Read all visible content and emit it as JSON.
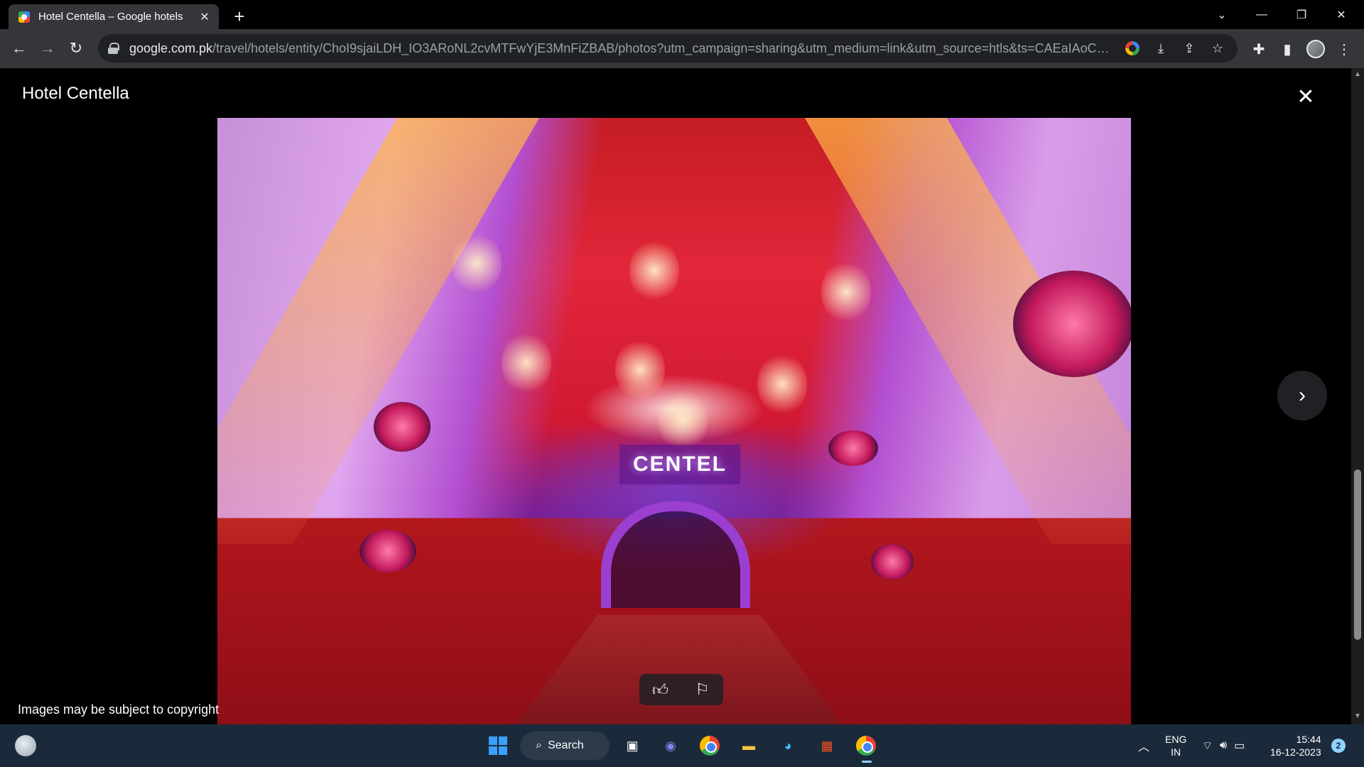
{
  "browser": {
    "tab_title": "Hotel Centella – Google hotels",
    "tab_close": "✕",
    "new_tab": "+",
    "url_host": "google.com.pk",
    "url_path": "/travel/hotels/entity/ChoI9sjaiLDH_IO3ARoNL2cvMTFwYjE3MnFiZBAB/photos?utm_campaign=sharing&utm_medium=link&utm_source=htls&ts=CAEaIAoCGgASGhI..."
  },
  "viewer": {
    "title": "Hotel Centella",
    "sign_text": "CENTEL",
    "copyright_notice": "Images may be subject to copyright"
  },
  "taskbar": {
    "search_label": "Search",
    "lang_line1": "ENG",
    "lang_line2": "IN",
    "time": "15:44",
    "date": "16-12-2023",
    "notification_count": "2"
  },
  "icons": {
    "accent": "#8fd3ff",
    "windows_blue": "#3aa0ff"
  }
}
